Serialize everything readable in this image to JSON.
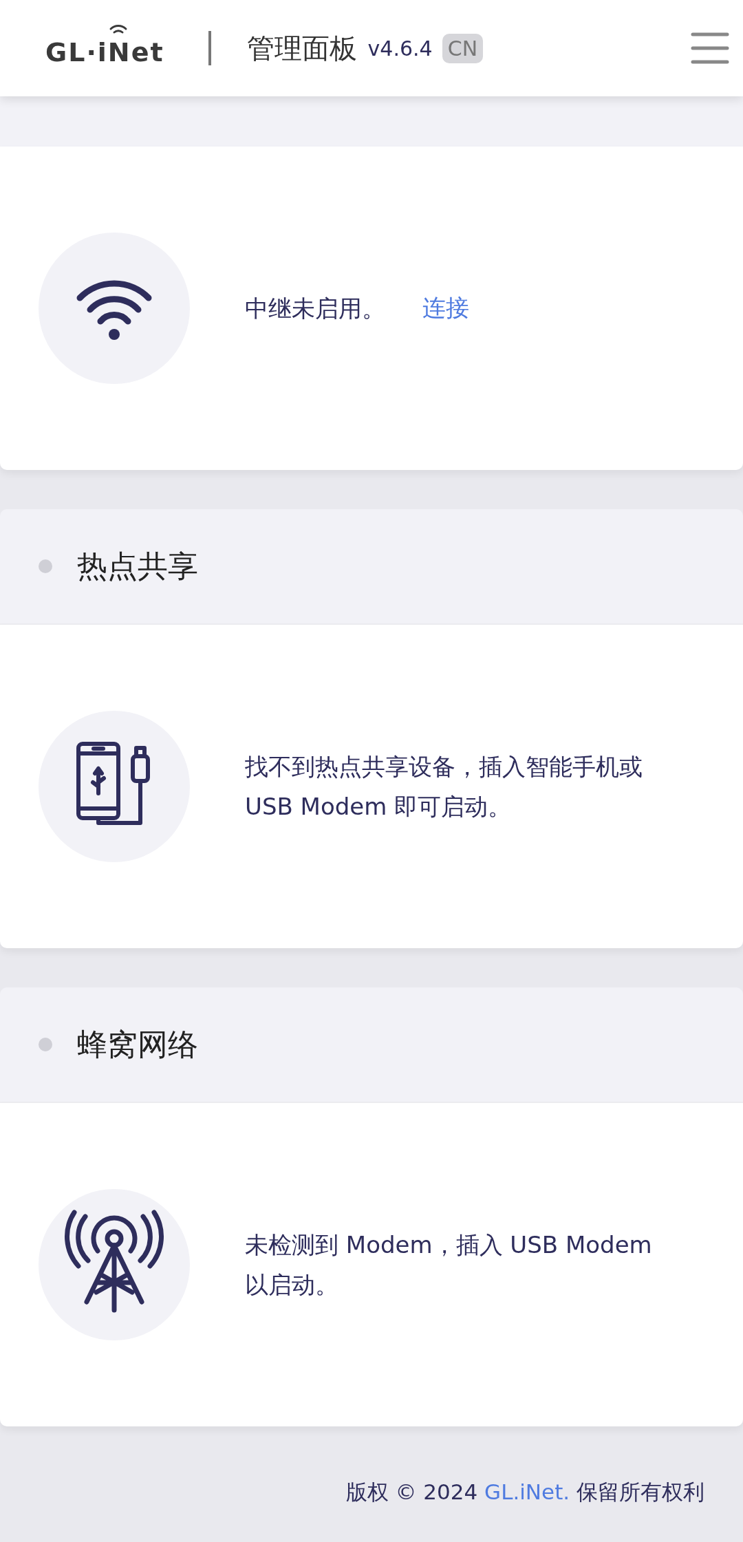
{
  "header": {
    "logo": "GL·iNet",
    "title": "管理面板",
    "version": "v4.6.4",
    "language": "CN"
  },
  "sections": [
    {
      "kind": "wifi",
      "message": "中继未启用。",
      "link": "连接"
    },
    {
      "kind": "phone",
      "title": "热点共享",
      "message": "找不到热点共享设备，插入智能手机或 USB Modem 即可启动。"
    },
    {
      "kind": "tower",
      "title": "蜂窝网络",
      "message": "未检测到 Modem，插入 USB Modem 以启动。"
    }
  ],
  "footer": {
    "prefix": "版权 © 2024",
    "link": "GL.iNet.",
    "suffix": "保留所有权利"
  }
}
